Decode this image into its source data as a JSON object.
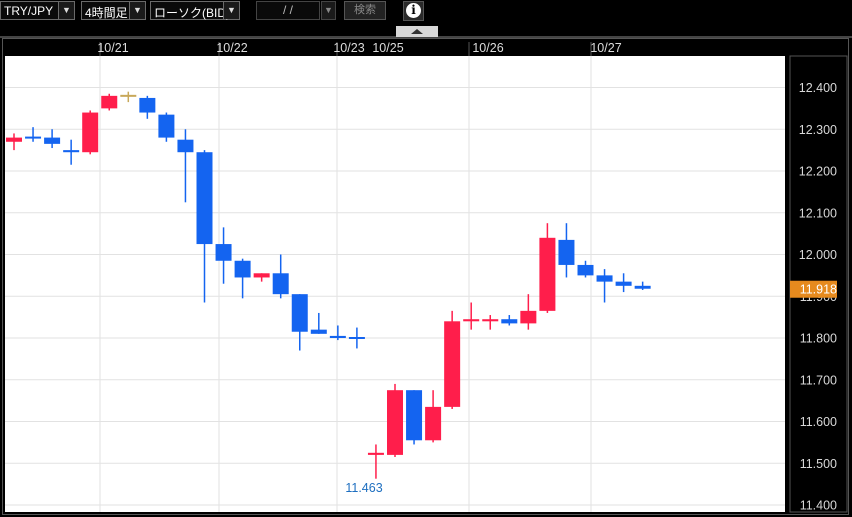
{
  "toolbar": {
    "pair": "TRY/JPY",
    "timeframe": "4時間足",
    "chart_kind": "ローソク(BID)",
    "date_placeholder": "/ /",
    "search_label": "検索",
    "info_icon": "info-icon",
    "collapse_icon": "caret-up-icon"
  },
  "colors": {
    "up": "#ff1e4b",
    "down": "#1464f0",
    "doji": "#c8a85a",
    "price_tag_bg": "#e68a1e",
    "plot_bg": "#ffffff",
    "page_bg": "#000000"
  },
  "chart_data": {
    "type": "candlestick",
    "title": "",
    "y_range": [
      11.4,
      12.45
    ],
    "y_ticks": [
      "12.400",
      "12.300",
      "12.200",
      "12.100",
      "12.000",
      "11.900",
      "11.800",
      "11.700",
      "11.600",
      "11.500",
      "11.400"
    ],
    "x_labels": [
      "10/21",
      "10/22",
      "10/23",
      "10/25",
      "10/26",
      "10/27"
    ],
    "last_price": "11.918",
    "min_label": "11.463",
    "grid": true,
    "candles": [
      {
        "o": 12.27,
        "h": 12.29,
        "l": 12.25,
        "c": 12.28
      },
      {
        "o": 12.28,
        "h": 12.305,
        "l": 12.27,
        "c": 12.28
      },
      {
        "o": 12.28,
        "h": 12.3,
        "l": 12.255,
        "c": 12.265
      },
      {
        "o": 12.25,
        "h": 12.275,
        "l": 12.215,
        "c": 12.245
      },
      {
        "o": 12.245,
        "h": 12.345,
        "l": 12.24,
        "c": 12.34
      },
      {
        "o": 12.35,
        "h": 12.385,
        "l": 12.345,
        "c": 12.38
      },
      {
        "o": 12.38,
        "h": 12.39,
        "l": 12.365,
        "c": 12.38
      },
      {
        "o": 12.375,
        "h": 12.38,
        "l": 12.325,
        "c": 12.34
      },
      {
        "o": 12.335,
        "h": 12.34,
        "l": 12.27,
        "c": 12.28
      },
      {
        "o": 12.275,
        "h": 12.3,
        "l": 12.125,
        "c": 12.245
      },
      {
        "o": 12.245,
        "h": 12.25,
        "l": 11.885,
        "c": 12.025
      },
      {
        "o": 12.025,
        "h": 12.065,
        "l": 11.93,
        "c": 11.985
      },
      {
        "o": 11.985,
        "h": 11.99,
        "l": 11.895,
        "c": 11.945
      },
      {
        "o": 11.945,
        "h": 11.955,
        "l": 11.935,
        "c": 11.955
      },
      {
        "o": 11.955,
        "h": 12.0,
        "l": 11.895,
        "c": 11.905
      },
      {
        "o": 11.905,
        "h": 11.905,
        "l": 11.77,
        "c": 11.815
      },
      {
        "o": 11.82,
        "h": 11.86,
        "l": 11.81,
        "c": 11.81
      },
      {
        "o": 11.805,
        "h": 11.83,
        "l": 11.795,
        "c": 11.8
      },
      {
        "o": 11.8,
        "h": 11.825,
        "l": 11.775,
        "c": 11.8
      },
      {
        "o": 11.52,
        "h": 11.545,
        "l": 11.463,
        "c": 11.525
      },
      {
        "o": 11.52,
        "h": 11.69,
        "l": 11.515,
        "c": 11.675
      },
      {
        "o": 11.675,
        "h": 11.675,
        "l": 11.545,
        "c": 11.555
      },
      {
        "o": 11.555,
        "h": 11.675,
        "l": 11.55,
        "c": 11.635
      },
      {
        "o": 11.635,
        "h": 11.865,
        "l": 11.63,
        "c": 11.84
      },
      {
        "o": 11.84,
        "h": 11.885,
        "l": 11.82,
        "c": 11.845
      },
      {
        "o": 11.84,
        "h": 11.855,
        "l": 11.82,
        "c": 11.845
      },
      {
        "o": 11.845,
        "h": 11.855,
        "l": 11.83,
        "c": 11.835
      },
      {
        "o": 11.835,
        "h": 11.905,
        "l": 11.82,
        "c": 11.865
      },
      {
        "o": 11.865,
        "h": 12.075,
        "l": 11.86,
        "c": 12.04
      },
      {
        "o": 12.035,
        "h": 12.075,
        "l": 11.945,
        "c": 11.975
      },
      {
        "o": 11.975,
        "h": 11.985,
        "l": 11.945,
        "c": 11.95
      },
      {
        "o": 11.95,
        "h": 11.965,
        "l": 11.885,
        "c": 11.935
      },
      {
        "o": 11.935,
        "h": 11.955,
        "l": 11.91,
        "c": 11.925
      },
      {
        "o": 11.925,
        "h": 11.935,
        "l": 11.915,
        "c": 11.918
      }
    ]
  }
}
